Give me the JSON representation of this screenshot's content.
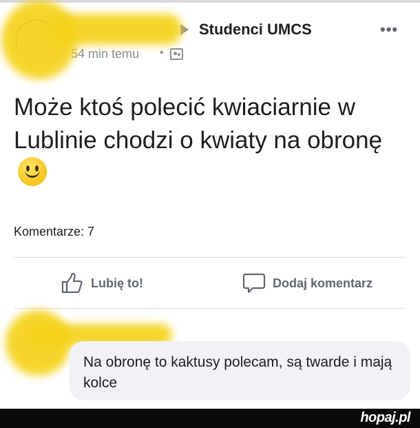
{
  "post": {
    "group_name": "Studenci UMCS",
    "time": "54 min temu",
    "separator": "•",
    "text": "Może ktoś polecić kwiaciarnie w Lublinie chodzi o kwiaty na obronę",
    "comments_count": "Komentarze: 7",
    "icons": {
      "more": "more-options-icon",
      "privacy": "group-icon",
      "arrow": "arrow-right-icon",
      "emoji": "smiley-emoji-icon"
    }
  },
  "actions": {
    "like_label": "Lubię to!",
    "comment_label": "Dodaj komentarz"
  },
  "comment": {
    "text": "Na obronę to kaktusy polecam, są twarde i mają kolce"
  },
  "footer": {
    "logo": "hopaj.pl"
  },
  "colors": {
    "censor_yellow": "#f5d21a",
    "text": "#1c1e21",
    "muted": "#606770",
    "bubble": "#f0f2f5"
  }
}
